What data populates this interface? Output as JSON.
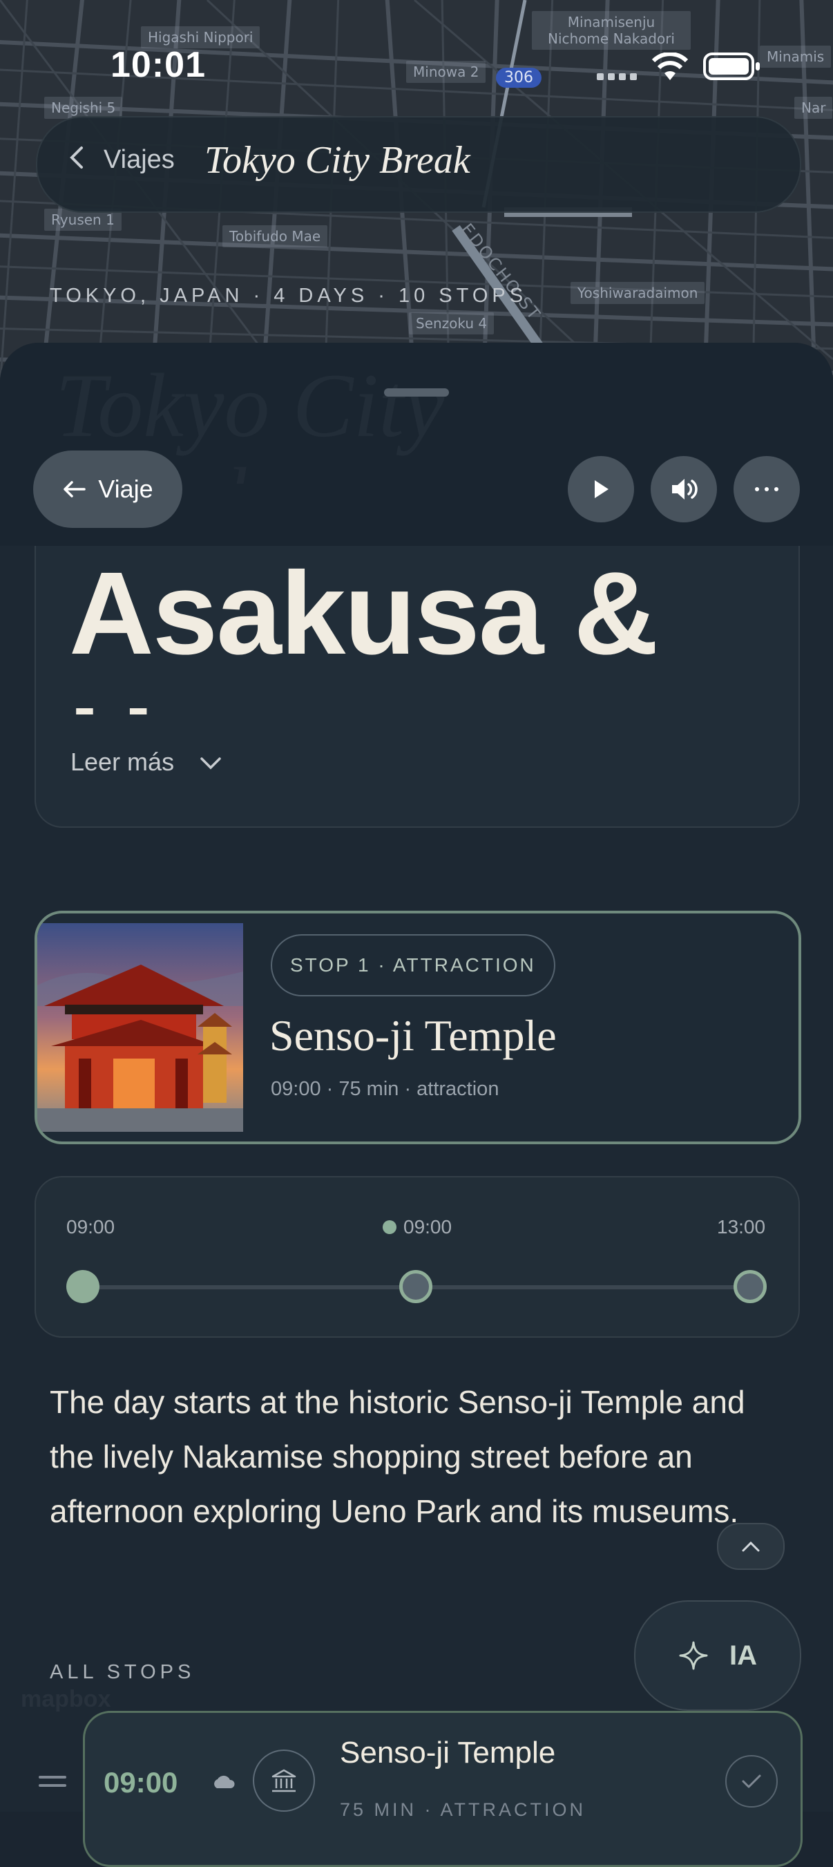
{
  "status_bar": {
    "time": "10:01"
  },
  "map": {
    "labels": [
      "Higashi Nippori",
      "Negishi 5",
      "Minowa 2",
      "Minamisenju Nichome Nakadori",
      "Ryusen 1",
      "Tobifudo Mae",
      "Yoshiwaradaimon",
      "Senzoku 4",
      "Minamis",
      "Nar"
    ],
    "street": "EDOCHO ST",
    "route_shield": "306"
  },
  "header": {
    "back_label": "Viajes",
    "trip_title": "Tokyo City Break",
    "meta": "TOKYO, JAPAN · 4 DAYS · 10 STOPS"
  },
  "sheet": {
    "ghost_title": "Tokyo City",
    "ghost_title_2": "Break",
    "back_button": "Viaje",
    "day_title": "Asakusa &\nUeno",
    "read_more": "Leer más"
  },
  "current_stop": {
    "badge": "STOP 1 · ATTRACTION",
    "name": "Senso-ji Temple",
    "subtitle": "09:00 · 75 min · attraction"
  },
  "timeline": {
    "start": "09:00",
    "current": "09:00",
    "end": "13:00"
  },
  "description": "The day starts at the historic Senso-ji Temple and the lively Nakamise shopping street before an afternoon exploring Ueno Park and its museums.",
  "ai_button": "IA",
  "all_stops_label": "ALL STOPS",
  "stops": [
    {
      "time": "09:00",
      "name": "Senso-ji Temple",
      "subtitle": "75 MIN · ATTRACTION"
    }
  ],
  "watermark": "mapbox",
  "colors": {
    "accent_green": "#8fb39a",
    "cream_text": "#f1ece1",
    "sheet_bg": "#1d2833"
  }
}
